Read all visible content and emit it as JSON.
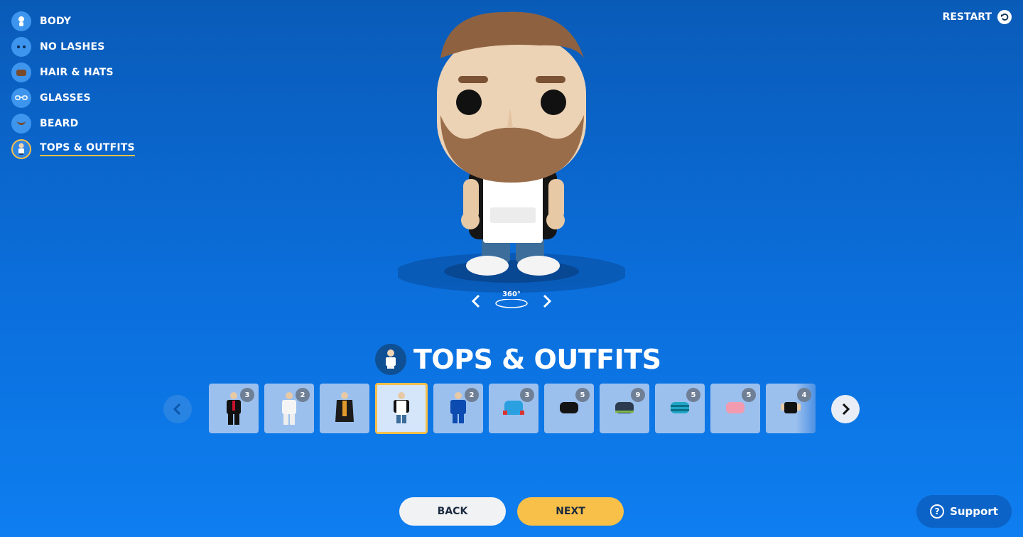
{
  "sidebar": {
    "items": [
      {
        "label": "BODY",
        "icon": "body-icon"
      },
      {
        "label": "NO LASHES",
        "icon": "eyes-icon"
      },
      {
        "label": "HAIR & HATS",
        "icon": "hair-icon"
      },
      {
        "label": "GLASSES",
        "icon": "glasses-icon"
      },
      {
        "label": "BEARD",
        "icon": "beard-icon"
      },
      {
        "label": "TOPS & OUTFITS",
        "icon": "outfit-icon",
        "active": true
      }
    ]
  },
  "header": {
    "restart_label": "RESTART"
  },
  "viewer": {
    "rotate_label": "360°"
  },
  "section": {
    "title": "TOPS & OUTFITS"
  },
  "outfits": {
    "tiles": [
      {
        "name": "black-suit",
        "count": "3"
      },
      {
        "name": "white-suit",
        "count": "2"
      },
      {
        "name": "dark-robe",
        "count": ""
      },
      {
        "name": "apron",
        "count": "",
        "selected": true
      },
      {
        "name": "blue-tracksuit",
        "count": "2"
      },
      {
        "name": "blue-sweater",
        "count": "3"
      },
      {
        "name": "black-longsleeve",
        "count": "5"
      },
      {
        "name": "navy-shirt",
        "count": "9"
      },
      {
        "name": "striped-shirt",
        "count": "5"
      },
      {
        "name": "pink-sweater",
        "count": "5"
      },
      {
        "name": "black-tank",
        "count": "4"
      }
    ]
  },
  "footer": {
    "back_label": "BACK",
    "next_label": "NEXT",
    "support_label": "Support"
  },
  "colors": {
    "accent": "#f7c04a",
    "background": "#0b6fdc",
    "tile": "#9cc0ee"
  }
}
